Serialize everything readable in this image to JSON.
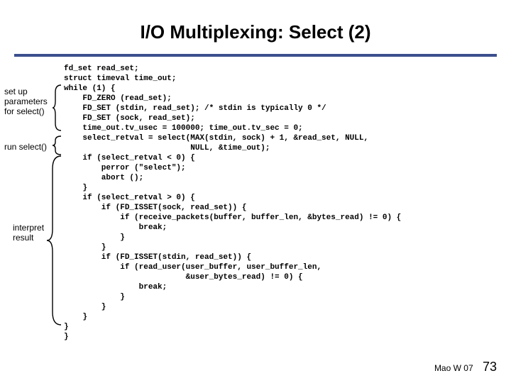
{
  "title": "I/O Multiplexing: Select (2)",
  "annotations": {
    "setup": "set up\nparameters\nfor select()",
    "run": "run select()",
    "interpret": "interpret\nresult"
  },
  "code": "fd_set read_set;\nstruct timeval time_out;\nwhile (1) {\n    FD_ZERO (read_set);\n    FD_SET (stdin, read_set); /* stdin is typically 0 */\n    FD_SET (sock, read_set);\n    time_out.tv_usec = 100000; time_out.tv_sec = 0;\n    select_retval = select(MAX(stdin, sock) + 1, &read_set, NULL,\n                           NULL, &time_out);\n    if (select_retval < 0) {\n        perror (\"select\");\n        abort ();\n    }\n    if (select_retval > 0) {\n        if (FD_ISSET(sock, read_set)) {\n            if (receive_packets(buffer, buffer_len, &bytes_read) != 0) {\n                break;\n            }\n        }\n        if (FD_ISSET(stdin, read_set)) {\n            if (read_user(user_buffer, user_buffer_len,\n                          &user_bytes_read) != 0) {\n                break;\n            }\n        }\n    }\n}\n}",
  "footer": {
    "credit": "Mao W 07",
    "page": "73"
  }
}
